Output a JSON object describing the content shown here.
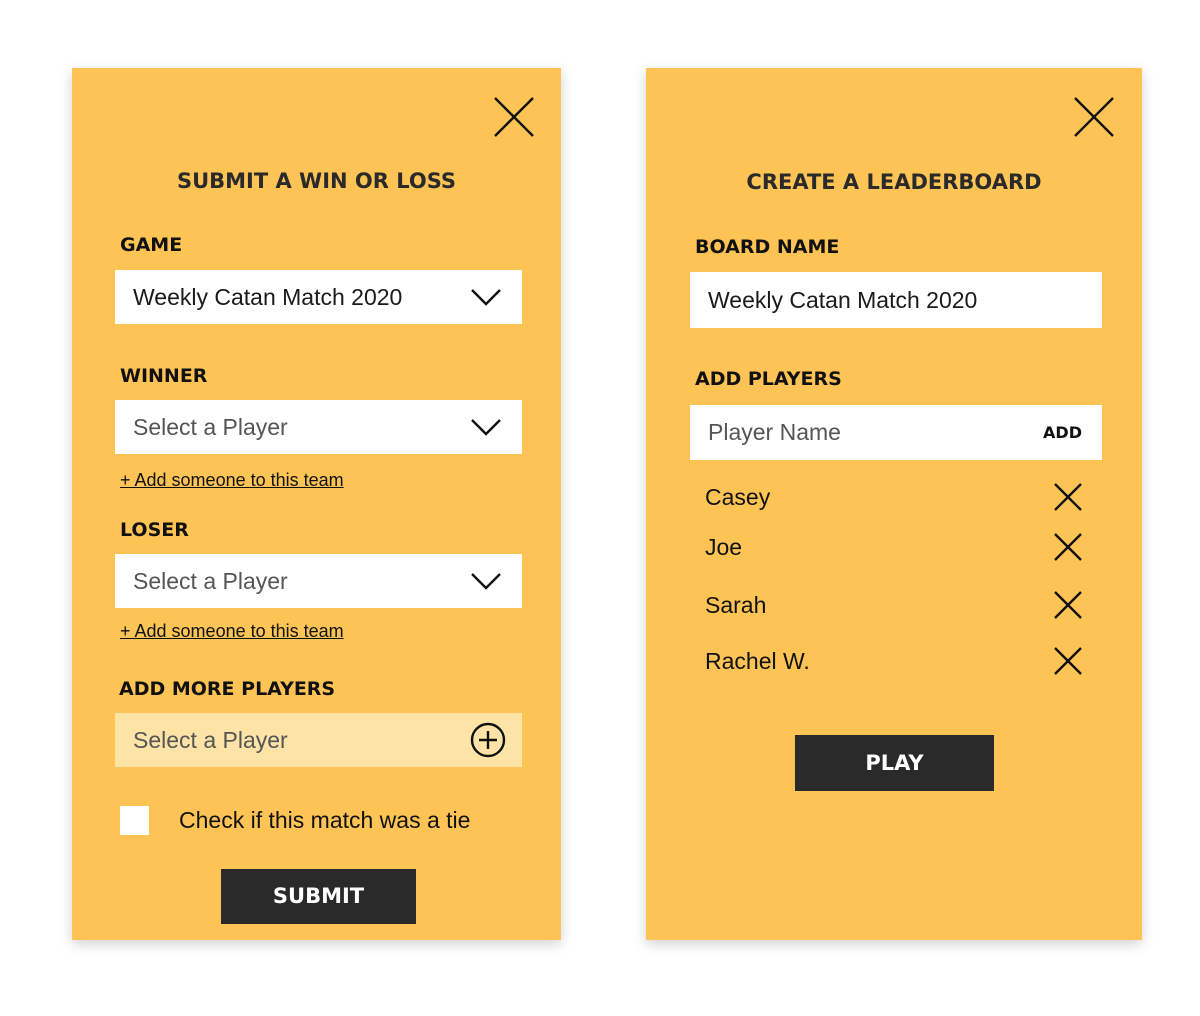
{
  "submit_panel": {
    "title": "SUBMIT A WIN OR LOSS",
    "game_label": "GAME",
    "game_value": "Weekly Catan Match 2020",
    "winner_label": "WINNER",
    "winner_placeholder": "Select a Player",
    "winner_add_link": "+ Add someone to this team",
    "loser_label": "LOSER",
    "loser_placeholder": "Select a Player",
    "loser_add_link": "+ Add someone to this team",
    "more_players_label": "ADD MORE PLAYERS",
    "more_players_placeholder": "Select a Player",
    "tie_checkbox_label": "Check if this match was a tie",
    "tie_checked": false,
    "submit_label": "SUBMIT"
  },
  "leaderboard_panel": {
    "title": "CREATE A LEADERBOARD",
    "board_name_label": "BOARD NAME",
    "board_name_value": "Weekly Catan Match 2020",
    "add_players_label": "ADD PLAYERS",
    "player_name_placeholder": "Player Name",
    "add_button_label": "ADD",
    "players": [
      {
        "name": "Casey"
      },
      {
        "name": "Joe"
      },
      {
        "name": "Sarah"
      },
      {
        "name": "Rachel W."
      }
    ],
    "play_label": "PLAY"
  },
  "colors": {
    "panel_background": "#fdc455",
    "field_background": "#ffffff",
    "disabled_field_background": "#fde3a6",
    "button_background": "#2a2a2a",
    "button_text": "#ffffff"
  },
  "icons": {
    "close": "close-icon",
    "dropdown": "chevron-down-icon",
    "add": "plus-circle-icon",
    "remove": "remove-x-icon"
  }
}
